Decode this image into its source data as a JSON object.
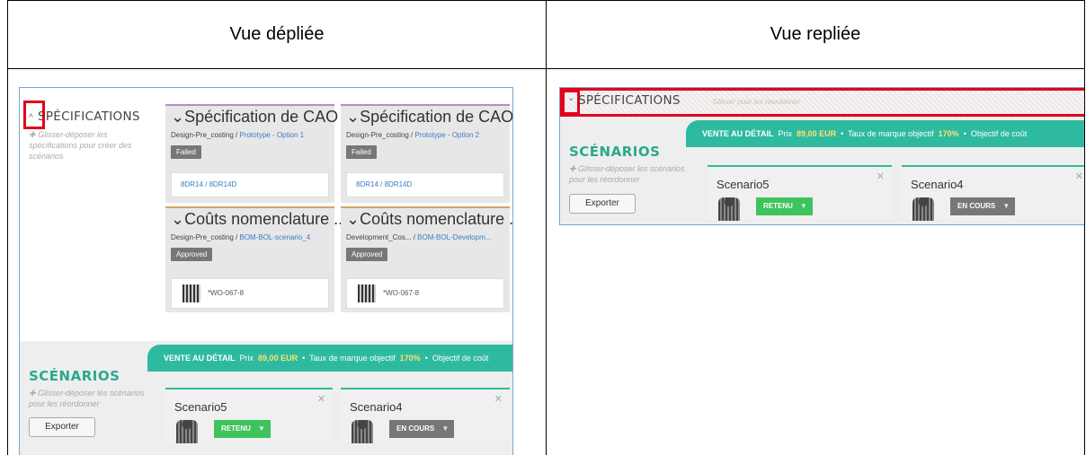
{
  "header": {
    "left": "Vue dépliée",
    "right": "Vue repliée"
  },
  "expanded": {
    "spec_section_title": "SPÉCIFICATIONS",
    "spec_hint": "Glisser-déposer les spécifications pour créer des scénarios",
    "cards": [
      {
        "title": "Spécification de CAO",
        "sub_prefix": "Design-Pre_costing / ",
        "sub_link": "Prototype - Option 1",
        "badge": "Failed",
        "ref": "8DR14 / 8DR14D"
      },
      {
        "title": "Spécification de CAO",
        "sub_prefix": "Design-Pre_costing / ",
        "sub_link": "Prototype - Option 2",
        "badge": "Failed",
        "ref": "8DR14 / 8DR14D"
      },
      {
        "title": "Coûts nomenclature ...",
        "sub_prefix": "Design-Pre_costing / ",
        "sub_link": "BOM-BOL-scenario_4",
        "badge": "Approved",
        "ref": "*WO-067-8"
      },
      {
        "title": "Coûts nomenclature ...",
        "sub_prefix": "Development_Cos... / ",
        "sub_link": "BOM-BOL-Developm...",
        "badge": "Approved",
        "ref": "*WO-067-8"
      }
    ],
    "band": {
      "label": "VENTE AU DÉTAIL",
      "price_label": "Prix",
      "price": "89,00 EUR",
      "margin_label": "Taux de marque objectif",
      "margin": "170%",
      "goal_label": "Objectif de coût"
    },
    "scenarios_title": "SCÉNARIOS",
    "scenarios_hint": "Glisser-déposer les scénarios pour les réordonner",
    "export_label": "Exporter",
    "scenarios": [
      {
        "name": "Scenario5",
        "status": "RETENU",
        "color": "#3ec35d"
      },
      {
        "name": "Scenario4",
        "status": "EN COURS",
        "color": "#777777"
      }
    ]
  },
  "collapsed": {
    "spec_section_title": "SPÉCIFICATIONS",
    "spec_hint": "Glisser pour les réordonner",
    "band": {
      "label": "VENTE AU DÉTAIL",
      "price_label": "Prix",
      "price": "89,00 EUR",
      "margin_label": "Taux de marque objectif",
      "margin": "170%",
      "goal_label": "Objectif de coût"
    },
    "scenarios_title": "SCÉNARIOS",
    "scenarios_hint": "Glisser-déposer les scénarios pour les réordonner",
    "export_label": "Exporter",
    "scenarios": [
      {
        "name": "Scenario5",
        "status": "RETENU"
      },
      {
        "name": "Scenario4",
        "status": "EN COURS"
      }
    ]
  },
  "colors": {
    "highlight": "#e3001b",
    "teal": "#2ebaa0",
    "purple_card": "#b48ad0",
    "orange_card": "#d5a36a"
  },
  "icons": {
    "expand": "chevron-up-icon",
    "collapse": "chevron-down-icon",
    "close": "close-icon",
    "dropdown": "caret-down-icon",
    "drag": "plus-icon"
  }
}
